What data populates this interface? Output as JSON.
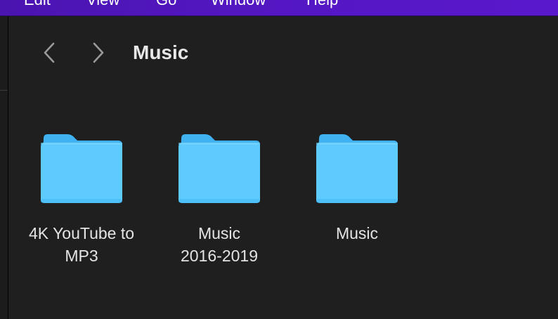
{
  "menubar": {
    "items": [
      "Edit",
      "View",
      "Go",
      "Window",
      "Help"
    ]
  },
  "toolbar": {
    "back_icon": "chevron-left-icon",
    "forward_icon": "chevron-right-icon",
    "title": "Music"
  },
  "folders": [
    {
      "line1": "4K YouTube to",
      "line2": "MP3",
      "icon": "folder-icon"
    },
    {
      "line1": "Music",
      "line2": "2016-2019",
      "icon": "folder-icon"
    },
    {
      "line1": "Music",
      "line2": "",
      "icon": "folder-icon"
    }
  ],
  "colors": {
    "menubar": "#5317c2",
    "window_bg": "#1f1f1f",
    "folder_front": "#5ecbff",
    "folder_back": "#3fb2ef",
    "text": "#e4e4e4"
  }
}
